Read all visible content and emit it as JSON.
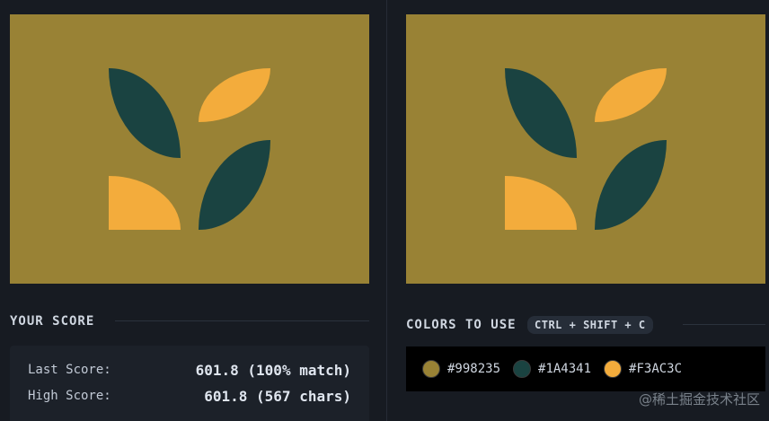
{
  "colors": {
    "background": "#998235",
    "dark": "#1A4341",
    "light": "#F3AC3C"
  },
  "score": {
    "heading": "YOUR SCORE",
    "last_label": "Last Score:",
    "last_value": "601.8 (100% match)",
    "high_label": "High Score:",
    "high_value": "601.8 (567 chars)"
  },
  "palette": {
    "heading": "COLORS TO USE",
    "shortcut": "CTRL + SHIFT + C",
    "swatches": [
      {
        "hex": "#998235",
        "label": "#998235"
      },
      {
        "hex": "#1A4341",
        "label": "#1A4341"
      },
      {
        "hex": "#F3AC3C",
        "label": "#F3AC3C"
      }
    ]
  },
  "watermark": "@稀土掘金技术社区"
}
